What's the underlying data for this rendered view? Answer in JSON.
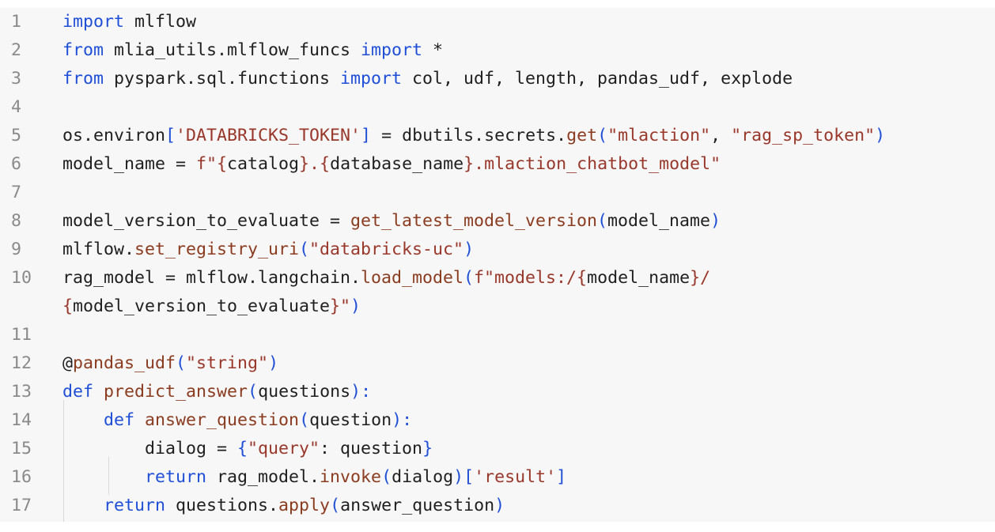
{
  "lines": [
    {
      "num": "1",
      "tokens": [
        {
          "t": "import",
          "c": "k"
        },
        {
          "t": " mlflow",
          "c": "b"
        }
      ]
    },
    {
      "num": "2",
      "tokens": [
        {
          "t": "from",
          "c": "k"
        },
        {
          "t": " mlia_utils.mlflow_funcs ",
          "c": "b"
        },
        {
          "t": "import",
          "c": "k"
        },
        {
          "t": " *",
          "c": "b"
        }
      ]
    },
    {
      "num": "3",
      "tokens": [
        {
          "t": "from",
          "c": "k"
        },
        {
          "t": " pyspark.sql.functions ",
          "c": "b"
        },
        {
          "t": "import",
          "c": "k"
        },
        {
          "t": " col, udf, length, pandas_udf, explode",
          "c": "b"
        }
      ]
    },
    {
      "num": "4",
      "tokens": []
    },
    {
      "num": "5",
      "tokens": [
        {
          "t": "os.environ",
          "c": "b"
        },
        {
          "t": "[",
          "c": "k"
        },
        {
          "t": "'DATABRICKS_TOKEN'",
          "c": "s"
        },
        {
          "t": "]",
          "c": "k"
        },
        {
          "t": " = dbutils.secrets.",
          "c": "b"
        },
        {
          "t": "get",
          "c": "f"
        },
        {
          "t": "(",
          "c": "k"
        },
        {
          "t": "\"mlaction\"",
          "c": "s"
        },
        {
          "t": ", ",
          "c": "b"
        },
        {
          "t": "\"rag_sp_token\"",
          "c": "s"
        },
        {
          "t": ")",
          "c": "k"
        }
      ]
    },
    {
      "num": "6",
      "tokens": [
        {
          "t": "model_name = ",
          "c": "b"
        },
        {
          "t": "f\"{",
          "c": "s"
        },
        {
          "t": "catalog",
          "c": "b"
        },
        {
          "t": "}.{",
          "c": "s"
        },
        {
          "t": "database_name",
          "c": "b"
        },
        {
          "t": "}.mlaction_chatbot_model\"",
          "c": "s"
        }
      ]
    },
    {
      "num": "7",
      "tokens": []
    },
    {
      "num": "8",
      "tokens": [
        {
          "t": "model_version_to_evaluate = ",
          "c": "b"
        },
        {
          "t": "get_latest_model_version",
          "c": "f"
        },
        {
          "t": "(",
          "c": "k"
        },
        {
          "t": "model_name",
          "c": "b"
        },
        {
          "t": ")",
          "c": "k"
        }
      ]
    },
    {
      "num": "9",
      "tokens": [
        {
          "t": "mlflow.",
          "c": "b"
        },
        {
          "t": "set_registry_uri",
          "c": "f"
        },
        {
          "t": "(",
          "c": "k"
        },
        {
          "t": "\"databricks-uc\"",
          "c": "s"
        },
        {
          "t": ")",
          "c": "k"
        }
      ]
    },
    {
      "num": "10",
      "tokens": [
        {
          "t": "rag_model = mlflow.langchain.",
          "c": "b"
        },
        {
          "t": "load_model",
          "c": "f"
        },
        {
          "t": "(",
          "c": "k"
        },
        {
          "t": "f\"models:/{",
          "c": "s"
        },
        {
          "t": "model_name",
          "c": "b"
        },
        {
          "t": "}/",
          "c": "s"
        }
      ]
    },
    {
      "num": "",
      "tokens": [
        {
          "t": "{",
          "c": "s"
        },
        {
          "t": "model_version_to_evaluate",
          "c": "b"
        },
        {
          "t": "}\"",
          "c": "s"
        },
        {
          "t": ")",
          "c": "k"
        }
      ]
    },
    {
      "num": "11",
      "tokens": []
    },
    {
      "num": "12",
      "tokens": [
        {
          "t": "@",
          "c": "b"
        },
        {
          "t": "pandas_udf",
          "c": "f"
        },
        {
          "t": "(",
          "c": "k"
        },
        {
          "t": "\"string\"",
          "c": "s"
        },
        {
          "t": ")",
          "c": "k"
        }
      ]
    },
    {
      "num": "13",
      "tokens": [
        {
          "t": "def",
          "c": "k"
        },
        {
          "t": " ",
          "c": "b"
        },
        {
          "t": "predict_answer",
          "c": "f"
        },
        {
          "t": "(",
          "c": "k"
        },
        {
          "t": "questions",
          "c": "b"
        },
        {
          "t": "):",
          "c": "k"
        }
      ]
    },
    {
      "num": "14",
      "tokens": [
        {
          "t": "    ",
          "c": "b"
        },
        {
          "t": "def",
          "c": "k"
        },
        {
          "t": " ",
          "c": "b"
        },
        {
          "t": "answer_question",
          "c": "f"
        },
        {
          "t": "(",
          "c": "k"
        },
        {
          "t": "question",
          "c": "b"
        },
        {
          "t": "):",
          "c": "k"
        }
      ]
    },
    {
      "num": "15",
      "tokens": [
        {
          "t": "        dialog = ",
          "c": "b"
        },
        {
          "t": "{",
          "c": "k"
        },
        {
          "t": "\"query\"",
          "c": "s"
        },
        {
          "t": ": question",
          "c": "b"
        },
        {
          "t": "}",
          "c": "k"
        }
      ]
    },
    {
      "num": "16",
      "tokens": [
        {
          "t": "        ",
          "c": "b"
        },
        {
          "t": "return",
          "c": "k"
        },
        {
          "t": " rag_model.",
          "c": "b"
        },
        {
          "t": "invoke",
          "c": "f"
        },
        {
          "t": "(",
          "c": "k"
        },
        {
          "t": "dialog",
          "c": "b"
        },
        {
          "t": ")[",
          "c": "k"
        },
        {
          "t": "'result'",
          "c": "s"
        },
        {
          "t": "]",
          "c": "k"
        }
      ]
    },
    {
      "num": "17",
      "tokens": [
        {
          "t": "    ",
          "c": "b"
        },
        {
          "t": "return",
          "c": "k"
        },
        {
          "t": " questions.",
          "c": "b"
        },
        {
          "t": "apply",
          "c": "f"
        },
        {
          "t": "(",
          "c": "k"
        },
        {
          "t": "answer_question",
          "c": "b"
        },
        {
          "t": ")",
          "c": "k"
        }
      ]
    }
  ]
}
